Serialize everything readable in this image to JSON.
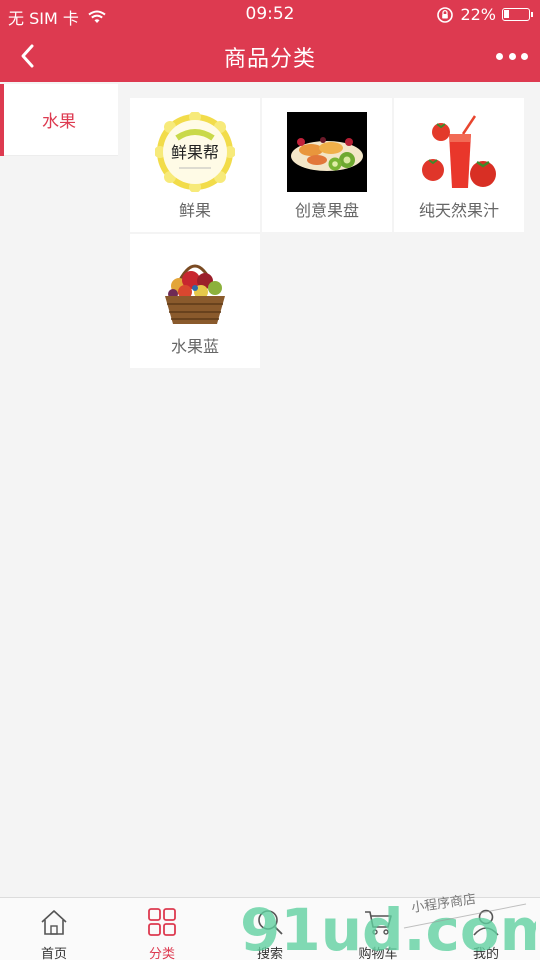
{
  "status_bar": {
    "carrier": "无 SIM 卡",
    "time": "09:52",
    "battery": "22%",
    "battery_level": 0.22
  },
  "header": {
    "title": "商品分类"
  },
  "sidebar": {
    "items": [
      {
        "label": "水果",
        "active": true
      }
    ]
  },
  "products": [
    {
      "label": "鲜果",
      "image": "xianguobang-logo",
      "logo_text": "鲜果帮"
    },
    {
      "label": "创意果盘",
      "image": "fruit-platter-photo"
    },
    {
      "label": "纯天然果汁",
      "image": "tomato-juice-photo"
    },
    {
      "label": "水果蓝",
      "image": "fruit-basket-photo"
    }
  ],
  "tab_bar": {
    "tabs": [
      {
        "label": "首页",
        "icon": "home-icon",
        "active": false
      },
      {
        "label": "分类",
        "icon": "grid-icon",
        "active": true
      },
      {
        "label": "搜索",
        "icon": "search-icon",
        "active": false
      },
      {
        "label": "购物车",
        "icon": "cart-icon",
        "active": false
      },
      {
        "label": "我的",
        "icon": "user-icon",
        "active": false
      }
    ]
  },
  "watermark": {
    "logo_text": "91ud.com",
    "tagline": "小程序商店"
  },
  "colors": {
    "primary": "#dd3a50",
    "background": "#f4f4f4",
    "text_gray": "#666666"
  }
}
